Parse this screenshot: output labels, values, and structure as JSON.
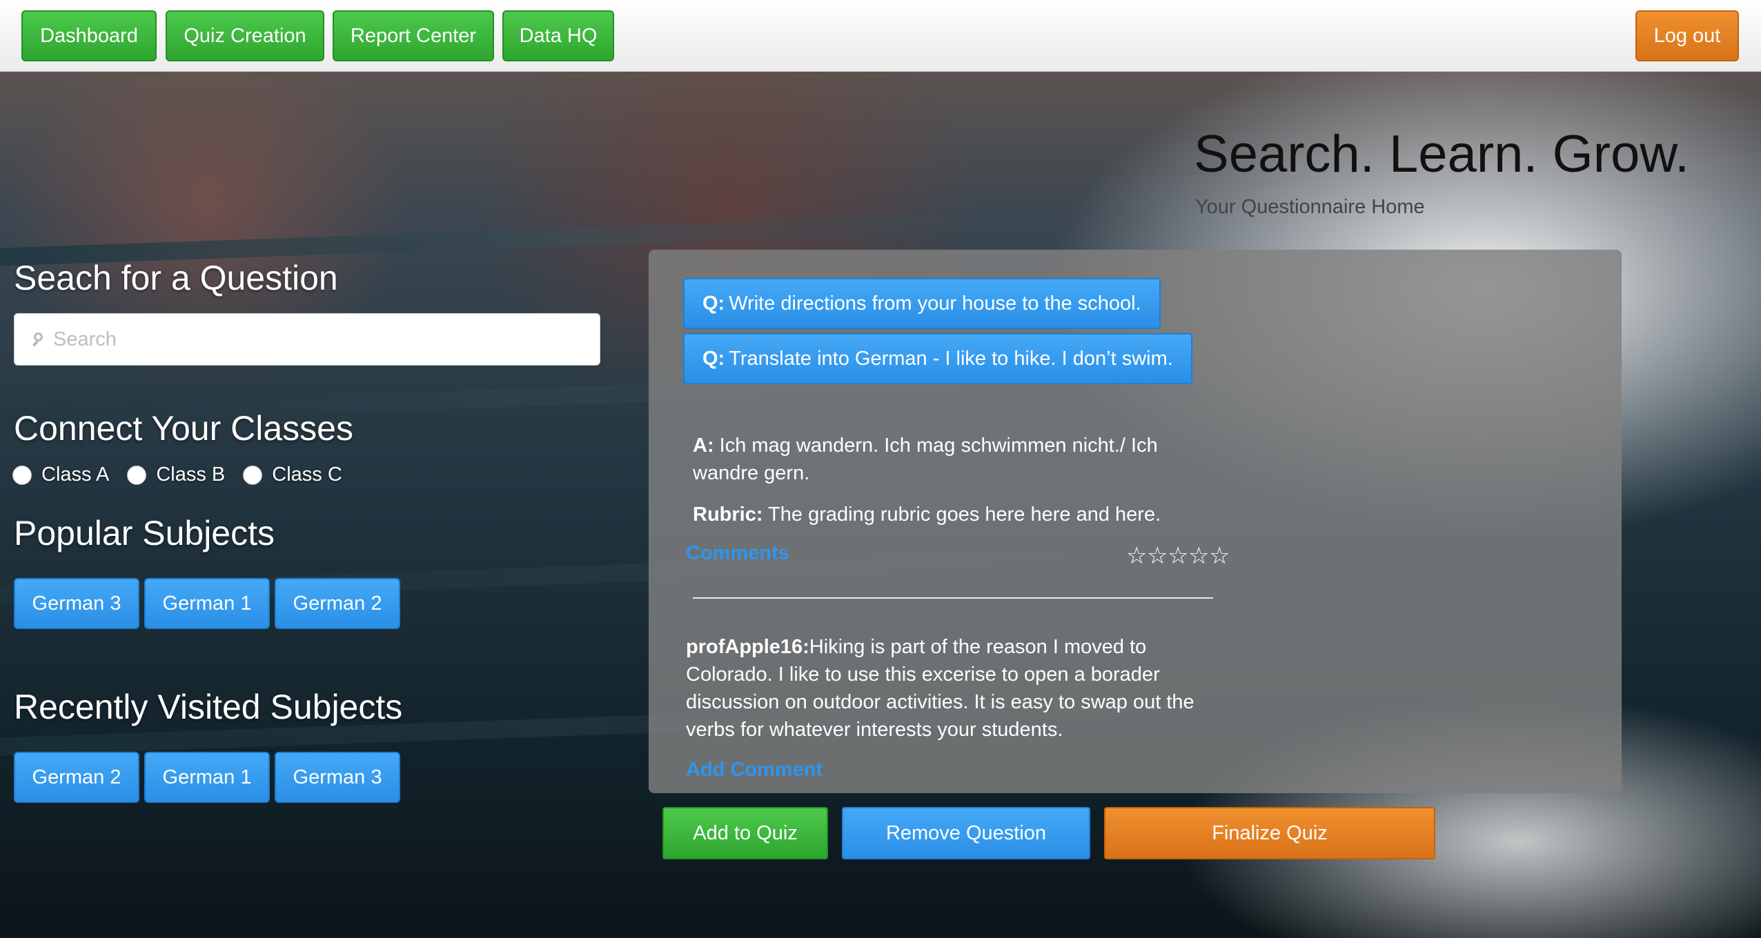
{
  "nav": {
    "dashboard": "Dashboard",
    "quiz_creation": "Quiz Creation",
    "report_center": "Report Center",
    "data_hq": "Data HQ",
    "logout": "Log out"
  },
  "hero": {
    "title": "Search. Learn. Grow.",
    "subtitle": "Your Questionnaire Home"
  },
  "search": {
    "heading": "Seach for a Question",
    "placeholder": "Search",
    "icon": "search-icon"
  },
  "classes": {
    "heading": "Connect Your Classes",
    "options": [
      "Class A",
      "Class B",
      "Class C"
    ]
  },
  "popular": {
    "heading": "Popular Subjects",
    "items": [
      "German 3",
      "German 1",
      "German 2"
    ]
  },
  "recent": {
    "heading": "Recently Visited Subjects",
    "items": [
      "German 2",
      "German 1",
      "German 3"
    ]
  },
  "questions": [
    {
      "prefix": "Q:",
      "text": "Write directions from your house to the school."
    },
    {
      "prefix": "Q:",
      "text": "Translate into German - I like to hike. I don’t swim."
    }
  ],
  "answer": {
    "prefix": "A:",
    "text": "Ich mag wandern. Ich mag schwimmen nicht./ Ich wandre gern."
  },
  "rubric": {
    "prefix": "Rubric:",
    "text": "The grading rubric goes here here and here."
  },
  "comments_label": "Comments",
  "rating": {
    "value": 0,
    "max": 5,
    "star_glyph": "☆"
  },
  "comment": {
    "author": "profApple16:",
    "text": "Hiking is part of the reason I moved to Colorado. I like to use this excerise to open a borader discussion on outdoor activities. It is easy to swap out the verbs for whatever interests your students."
  },
  "add_comment_label": "Add Comment",
  "actions": {
    "add": "Add to Quiz",
    "remove": "Remove Question",
    "finalize": "Finalize Quiz"
  },
  "colors": {
    "green": "#2fa62f",
    "blue": "#2a8fe6",
    "orange": "#d9731a",
    "link": "#2f95ef"
  }
}
